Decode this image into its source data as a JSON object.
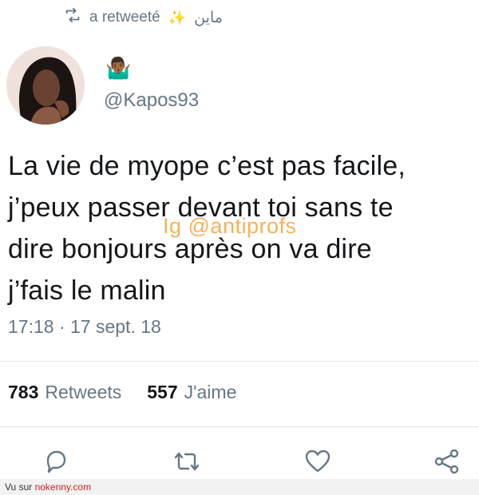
{
  "retweet": {
    "label": "a retweeté",
    "sparkle": "✨",
    "name": "ماين"
  },
  "author": {
    "emoji": "🤷🏾‍♂️",
    "handle": "@Kapos93"
  },
  "tweet": {
    "lines": [
      "La vie de myope c’est pas facile,",
      "j’peux passer devant toi sans te",
      "dire bonjours après on va dire",
      "j’fais le malin"
    ],
    "timestamp": "17:18 · 17 sept. 18"
  },
  "watermark": "Ig @antiprofs",
  "stats": {
    "retweets_count": "783",
    "retweets_label": "Retweets",
    "likes_count": "557",
    "likes_label": "J'aime"
  },
  "actions": [
    "reply-icon",
    "retweet-icon",
    "like-icon",
    "share-icon"
  ],
  "footer": {
    "prefix": "Vu sur ",
    "site": "nokenny.com"
  },
  "colors": {
    "secondary_text": "#657786",
    "watermark": "#f6a43a",
    "divider": "#e1e8ed",
    "footer_link": "#d0221c"
  }
}
